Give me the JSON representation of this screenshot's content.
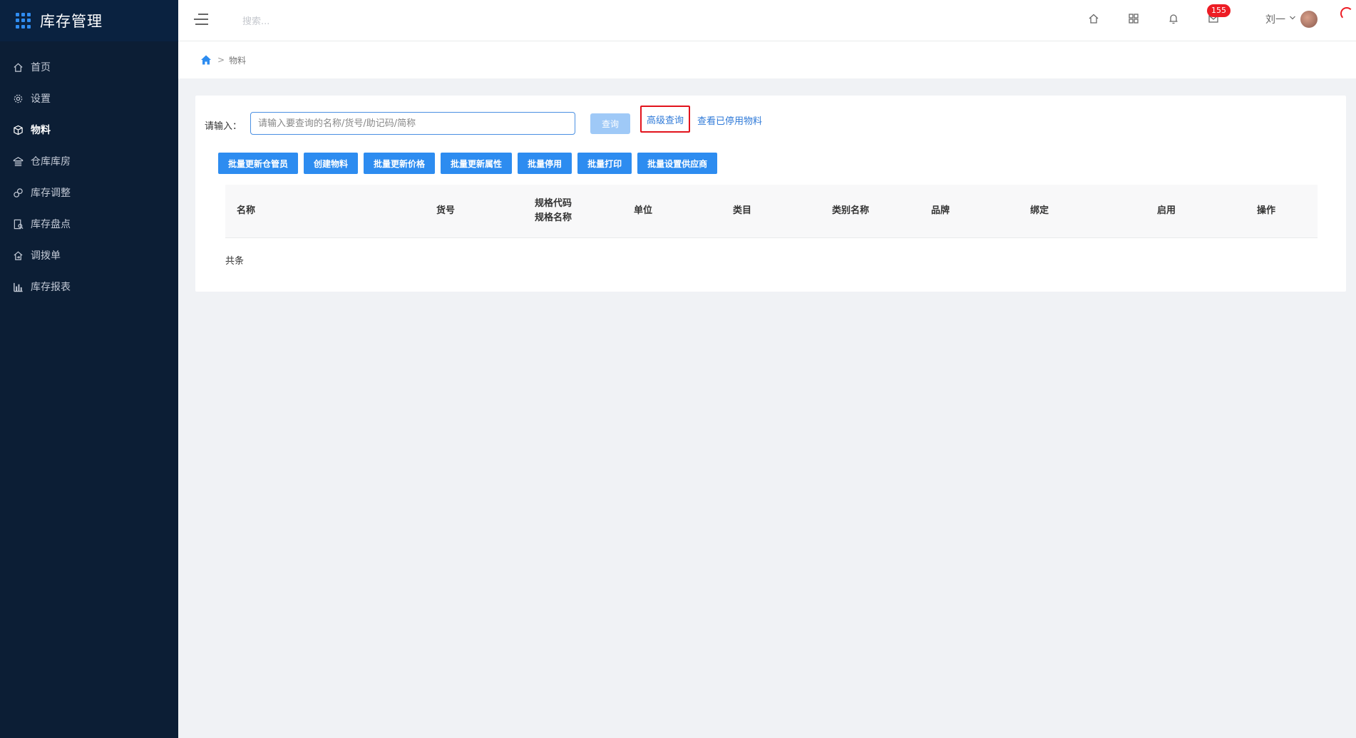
{
  "app": {
    "title": "库存管理"
  },
  "sidebar": {
    "items": [
      {
        "label": "首页",
        "icon": "home-icon",
        "active": false
      },
      {
        "label": "设置",
        "icon": "gear-icon",
        "active": false
      },
      {
        "label": "物料",
        "icon": "box-icon",
        "active": true
      },
      {
        "label": "仓库库房",
        "icon": "warehouse-icon",
        "active": false
      },
      {
        "label": "库存调整",
        "icon": "adjust-icon",
        "active": false
      },
      {
        "label": "库存盘点",
        "icon": "inventory-check-icon",
        "active": false
      },
      {
        "label": "调拨单",
        "icon": "transfer-icon",
        "active": false
      },
      {
        "label": "库存报表",
        "icon": "bar-chart-icon",
        "active": false
      }
    ]
  },
  "header": {
    "search_placeholder": "搜索...",
    "badge_count": "155",
    "user_name": "刘一"
  },
  "breadcrumb": {
    "current": "物料",
    "separator": ">"
  },
  "query": {
    "label": "请输入：",
    "placeholder": "请输入要查询的名称/货号/助记码/简称",
    "search_button": "查询",
    "advanced_link": "高级查询",
    "disabled_link": "查看已停用物料"
  },
  "actions": [
    "批量更新仓管员",
    "创建物料",
    "批量更新价格",
    "批量更新属性",
    "批量停用",
    "批量打印",
    "批量设置供应商"
  ],
  "table": {
    "columns": [
      "名称",
      "货号",
      "规格代码\n规格名称",
      "单位",
      "类目",
      "类别名称",
      "品牌",
      "绑定",
      "启用",
      "操作"
    ],
    "total_label": "共条"
  },
  "colors": {
    "primary": "#2d8cf0",
    "sidebar_bg": "#0c1e35",
    "highlight_border": "#e2131c",
    "badge": "#ed1c24"
  }
}
